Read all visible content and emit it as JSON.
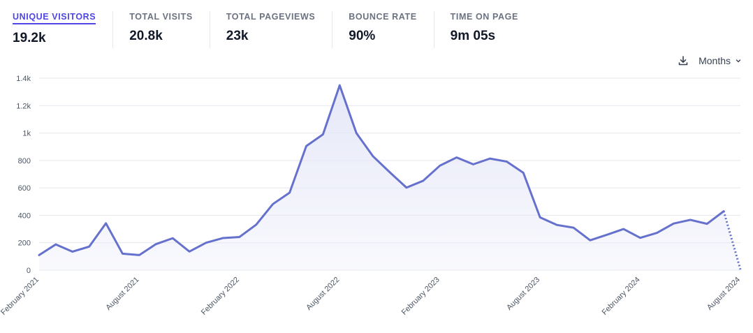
{
  "stats": [
    {
      "label": "UNIQUE VISITORS",
      "value": "19.2k",
      "active": true
    },
    {
      "label": "TOTAL VISITS",
      "value": "20.8k",
      "active": false
    },
    {
      "label": "TOTAL PAGEVIEWS",
      "value": "23k",
      "active": false
    },
    {
      "label": "BOUNCE RATE",
      "value": "90%",
      "active": false
    },
    {
      "label": "TIME ON PAGE",
      "value": "9m 05s",
      "active": false
    }
  ],
  "controls": {
    "download_icon": "download-icon",
    "interval_label": "Months",
    "interval_icon": "chevron-down-icon"
  },
  "colors": {
    "accent": "#4f46e5",
    "line": "#6571cc",
    "fill": "#e6e8f8",
    "grid": "#e5e7eb"
  },
  "chart_data": {
    "type": "area",
    "title": "",
    "xlabel": "",
    "ylabel": "",
    "ylim": [
      0,
      1400
    ],
    "yticks": [
      {
        "value": 0,
        "label": "0"
      },
      {
        "value": 200,
        "label": "200"
      },
      {
        "value": 400,
        "label": "400"
      },
      {
        "value": 600,
        "label": "600"
      },
      {
        "value": 800,
        "label": "800"
      },
      {
        "value": 1000,
        "label": "1k"
      },
      {
        "value": 1200,
        "label": "1.2k"
      },
      {
        "value": 1400,
        "label": "1.4k"
      }
    ],
    "grid": true,
    "x": [
      "2021-02",
      "2021-03",
      "2021-04",
      "2021-05",
      "2021-06",
      "2021-07",
      "2021-08",
      "2021-09",
      "2021-10",
      "2021-11",
      "2021-12",
      "2022-01",
      "2022-02",
      "2022-03",
      "2022-04",
      "2022-05",
      "2022-06",
      "2022-07",
      "2022-08",
      "2022-09",
      "2022-10",
      "2022-11",
      "2022-12",
      "2023-01",
      "2023-02",
      "2023-03",
      "2023-04",
      "2023-05",
      "2023-06",
      "2023-07",
      "2023-08",
      "2023-09",
      "2023-10",
      "2023-11",
      "2023-12",
      "2024-01",
      "2024-02",
      "2024-03",
      "2024-04",
      "2024-05",
      "2024-06",
      "2024-07",
      "2024-08"
    ],
    "xticks": [
      {
        "index": 0,
        "label": "February 2021"
      },
      {
        "index": 6,
        "label": "August 2021"
      },
      {
        "index": 12,
        "label": "February 2022"
      },
      {
        "index": 18,
        "label": "August 2022"
      },
      {
        "index": 24,
        "label": "February 2023"
      },
      {
        "index": 30,
        "label": "August 2023"
      },
      {
        "index": 36,
        "label": "February 2024"
      },
      {
        "index": 42,
        "label": "August 2024"
      }
    ],
    "series": [
      {
        "values": [
          110,
          188,
          135,
          172,
          342,
          120,
          110,
          190,
          233,
          136,
          200,
          234,
          242,
          332,
          482,
          565,
          905,
          990,
          1348,
          1000,
          830,
          714,
          602,
          652,
          762,
          822,
          772,
          814,
          792,
          710,
          385,
          330,
          310,
          218,
          258,
          300,
          236,
          272,
          340,
          367,
          338,
          430,
          5
        ],
        "dashed_from_index": 41
      }
    ]
  }
}
